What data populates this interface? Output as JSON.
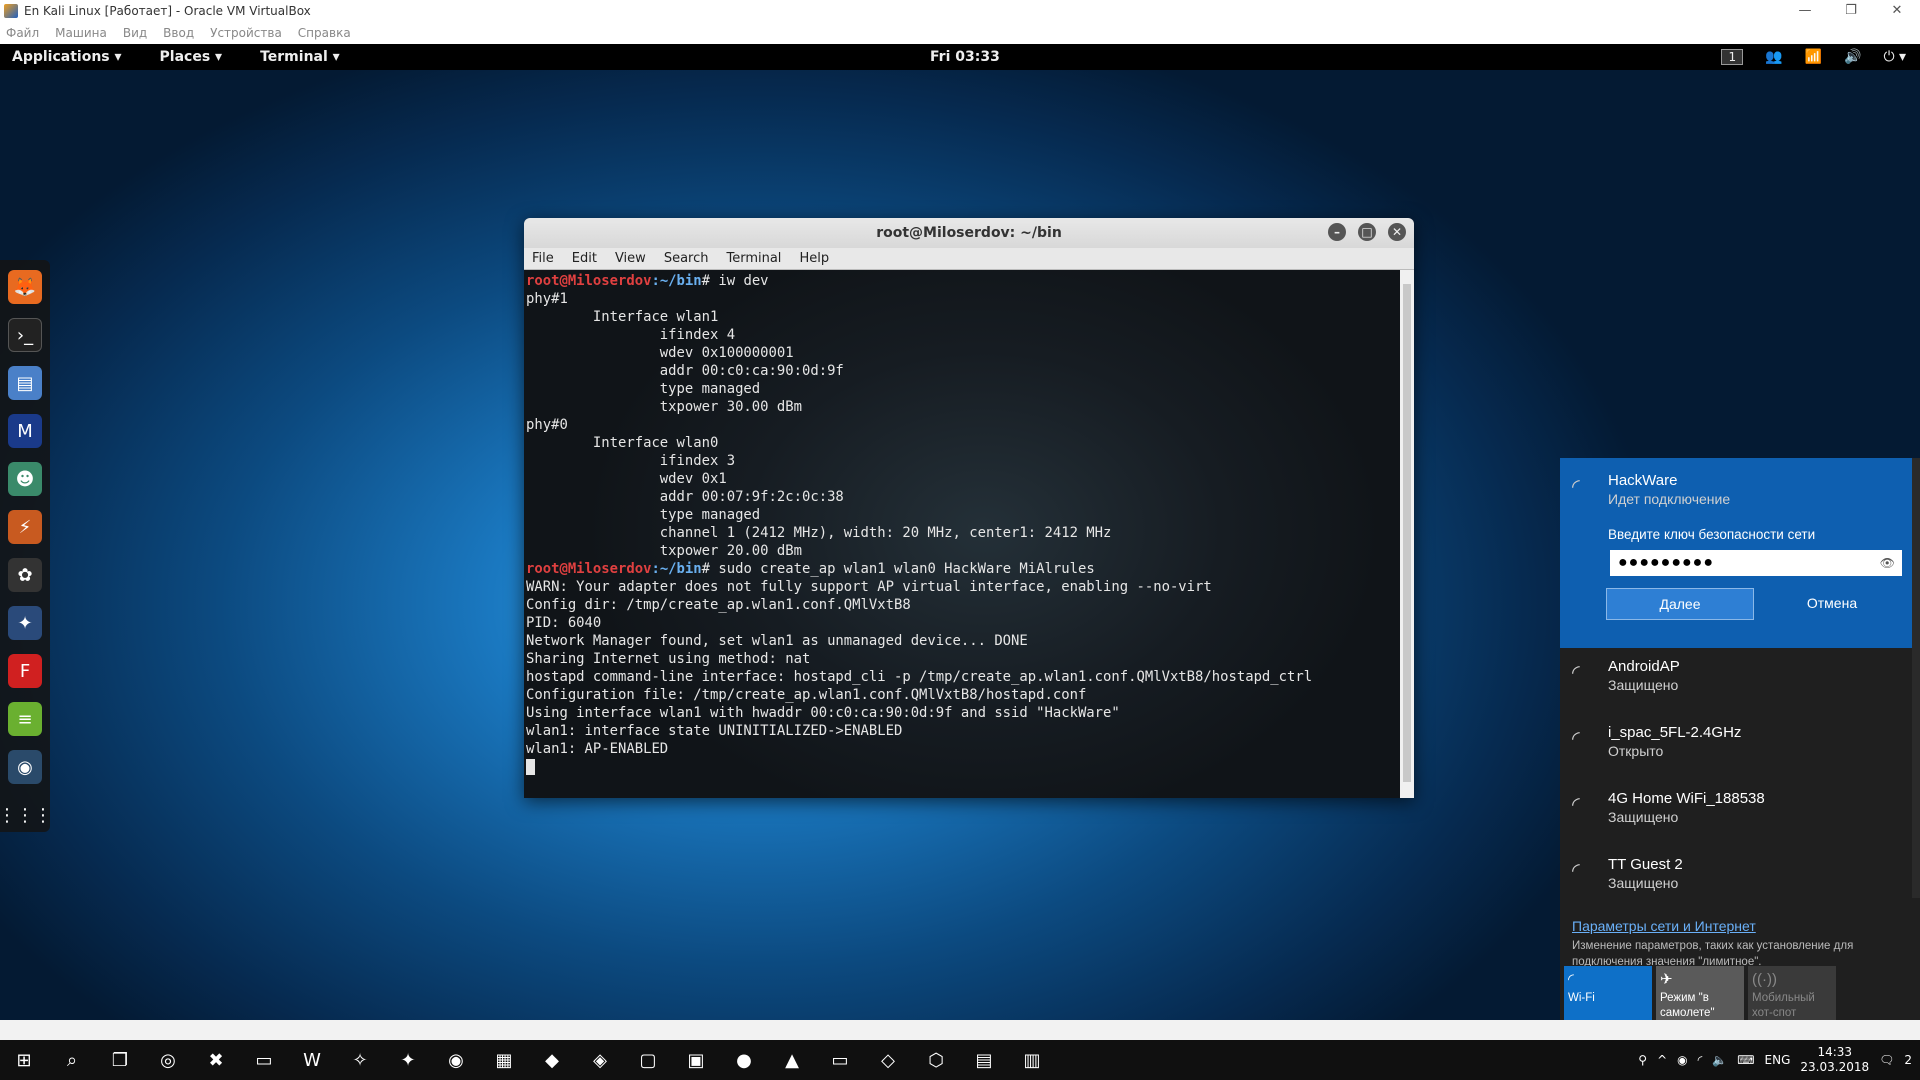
{
  "vbox": {
    "title": "En Kali Linux [Работает] - Oracle VM VirtualBox",
    "menu": [
      "Файл",
      "Машина",
      "Вид",
      "Ввод",
      "Устройства",
      "Справка"
    ],
    "minimize": "—",
    "maximize": "❐",
    "close": "✕"
  },
  "topbar": {
    "applications": "Applications ▾",
    "places": "Places ▾",
    "terminal": "Terminal ▾",
    "clock": "Fri 03:33",
    "workspace": "1"
  },
  "terminal": {
    "title": "root@Miloserdov: ~/bin",
    "menu": [
      "File",
      "Edit",
      "View",
      "Search",
      "Terminal",
      "Help"
    ],
    "prompt_user": "root@Miloserdov",
    "prompt_path": ":~/bin",
    "cmd1": "# iw dev",
    "output1": [
      "phy#1",
      "\tInterface wlan1",
      "\t\tifindex 4",
      "\t\twdev 0x100000001",
      "\t\taddr 00:c0:ca:90:0d:9f",
      "\t\ttype managed",
      "\t\ttxpower 30.00 dBm",
      "phy#0",
      "\tInterface wlan0",
      "\t\tifindex 3",
      "\t\twdev 0x1",
      "\t\taddr 00:07:9f:2c:0c:38",
      "\t\ttype managed",
      "\t\tchannel 1 (2412 MHz), width: 20 MHz, center1: 2412 MHz",
      "\t\ttxpower 20.00 dBm"
    ],
    "cmd2": "# sudo create_ap wlan1 wlan0 HackWare MiAlrules",
    "output2": [
      "WARN: Your adapter does not fully support AP virtual interface, enabling --no-virt",
      "Config dir: /tmp/create_ap.wlan1.conf.QMlVxtB8",
      "PID: 6040",
      "Network Manager found, set wlan1 as unmanaged device... DONE",
      "Sharing Internet using method: nat",
      "hostapd command-line interface: hostapd_cli -p /tmp/create_ap.wlan1.conf.QMlVxtB8/hostapd_ctrl",
      "Configuration file: /tmp/create_ap.wlan1.conf.QMlVxtB8/hostapd.conf",
      "Using interface wlan1 with hwaddr 00:c0:ca:90:0d:9f and ssid \"HackWare\"",
      "wlan1: interface state UNINITIALIZED->ENABLED",
      "wlan1: AP-ENABLED"
    ]
  },
  "network": {
    "selected": {
      "name": "HackWare",
      "status": "Идет подключение",
      "key_label": "Введите ключ безопасности сети",
      "key_value": "●●●●●●●●●",
      "next_btn": "Далее",
      "cancel_btn": "Отмена"
    },
    "items": [
      {
        "name": "AndroidAP",
        "status": "Защищено"
      },
      {
        "name": "i_spac_5FL-2.4GHz",
        "status": "Открыто"
      },
      {
        "name": "4G Home WiFi_188538",
        "status": "Защищено"
      },
      {
        "name": "TT Guest 2",
        "status": "Защищено"
      }
    ],
    "settings_link": "Параметры сети и Интернет",
    "settings_desc": "Изменение параметров, таких как установление для подключения значения \"лимитное\".",
    "quick": [
      {
        "label": "Wi-Fi"
      },
      {
        "label": "Режим \"в самолете\""
      },
      {
        "label": "Мобильный хот-спот"
      }
    ]
  },
  "tray": {
    "lang": "ENG",
    "time": "14:33",
    "date": "23.03.2018",
    "notif": "2"
  }
}
